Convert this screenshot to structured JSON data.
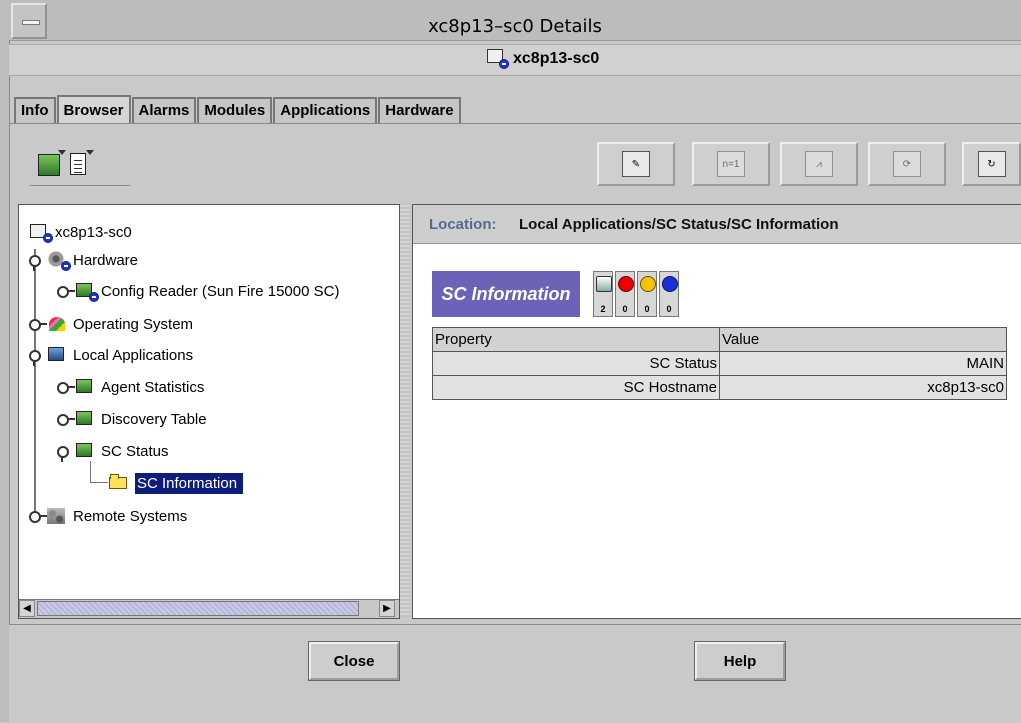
{
  "window": {
    "title": "xc8p13–sc0 Details",
    "host": "xc8p13-sc0"
  },
  "tabs": [
    {
      "label": "Info",
      "active": false
    },
    {
      "label": "Browser",
      "active": true
    },
    {
      "label": "Alarms",
      "active": false
    },
    {
      "label": "Modules",
      "active": false
    },
    {
      "label": "Applications",
      "active": false
    },
    {
      "label": "Hardware",
      "active": false
    }
  ],
  "toolbar": {
    "left_icons": [
      "module-tree-icon",
      "document-menu-icon"
    ],
    "right_buttons": [
      {
        "icon": "edit-notes-icon",
        "glyph": "✎",
        "enabled": true
      },
      {
        "icon": "set-value-icon",
        "glyph": "n=1",
        "enabled": false
      },
      {
        "icon": "graph-icon",
        "glyph": "⩘",
        "enabled": false
      },
      {
        "icon": "refresh-module-icon",
        "glyph": "⟳",
        "enabled": false
      },
      {
        "icon": "refresh-icon",
        "glyph": "↻",
        "enabled": true
      }
    ]
  },
  "tree": {
    "root": "xc8p13-sc0",
    "items": [
      {
        "label": "Hardware"
      },
      {
        "label": "Config Reader (Sun Fire 15000 SC)"
      },
      {
        "label": "Operating System"
      },
      {
        "label": "Local Applications"
      },
      {
        "label": "Agent Statistics"
      },
      {
        "label": "Discovery Table"
      },
      {
        "label": "SC Status"
      },
      {
        "label": "SC Information",
        "selected": true
      },
      {
        "label": "Remote Systems"
      }
    ]
  },
  "content": {
    "location_label": "Location:",
    "location_path": "Local Applications/SC Status/SC Information",
    "title": "SC Information",
    "status_counts": [
      "2",
      "0",
      "0",
      "0"
    ],
    "table": {
      "headers": [
        "Property",
        "Value"
      ],
      "rows": [
        [
          "SC Status",
          "MAIN"
        ],
        [
          "SC Hostname",
          "xc8p13-sc0"
        ]
      ]
    }
  },
  "buttons": {
    "close": "Close",
    "help": "Help"
  },
  "colors": {
    "selection": "#0c1d7a",
    "title_block": "#6a63b8",
    "location_label": "#536b90"
  }
}
